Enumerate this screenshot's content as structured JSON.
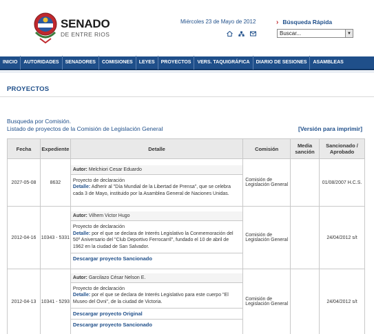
{
  "header": {
    "brand_title": "SENADO",
    "brand_subtitle": "DE ENTRE RIOS",
    "date": "Miércoles 23 de Mayo de 2012",
    "icons": [
      "home-icon",
      "sitemap-icon",
      "mail-icon"
    ],
    "quick_search_label": "Búsqueda Rápida",
    "quick_search_select": "Buscar..."
  },
  "nav": {
    "items": [
      "INICIO",
      "AUTORIDADES",
      "SENADORES",
      "COMISIONES",
      "LEYES",
      "PROYECTOS",
      "VERS. TAQUIGRÁFICA",
      "DIARIO DE SESIONES",
      "ASAMBLEAS"
    ]
  },
  "page": {
    "title": "PROYECTOS",
    "search_line1": "Busqueda por Comisión.",
    "search_line2": "Listado de proyectos de la Comisión de Legislación General",
    "print_link": "[Versión para imprimir]"
  },
  "table": {
    "headers": {
      "fecha": "Fecha",
      "expediente": "Expediente",
      "detalle": "Detalle",
      "comision": "Comisión",
      "media": "Media sanción",
      "sancionado": "Sancionado / Aprobado"
    },
    "author_label": "Autor:",
    "detail_label": "Detalle:",
    "rows": [
      {
        "fecha": "2027-05-08",
        "expediente": "8632",
        "autor": "Melchiori Cesar Eduardo",
        "tipo": "Proyecto de declaración",
        "detalle": "Adherir al \"Día Mundial de la Libertad de Prensa\", que se celebra cada 3 de Mayo, instituido por la Asamblea General de Naciones Unidas.",
        "comision": "Comisión de Legislación General",
        "media": "",
        "sancionado": "01/08/2007 H.C.S.",
        "links": []
      },
      {
        "fecha": "2012-04-16",
        "expediente": "10343 - 5331",
        "autor": "Vilhem Victor Hugo",
        "tipo": "Proyecto de declaración",
        "detalle": "por el que se declara de Interés Legislativo la Conmemoración del 50º Aniversario del \"Club Deportivo Ferrocarril\", fundado el 10 de abril de 1962 en la ciudad de San Salvador.",
        "comision": "Comisión de Legislación General",
        "media": "",
        "sancionado": "24/04/2012 s/t",
        "links": [
          "Descargar proyecto Sancionado"
        ]
      },
      {
        "fecha": "2012-04-13",
        "expediente": "10341 - 5293",
        "autor": "Garcilazo César Nelson E.",
        "tipo": "Proyecto de declaración",
        "detalle": "por el que se declara de Interés Legislativo para este cuerpo \"El Museo del Ovni\", de la ciudad de Victoria.",
        "comision": "Comisión de Legislación General",
        "media": "",
        "sancionado": "24/04/2012 s/t",
        "links": [
          "Descargar proyecto Original",
          "Descargar proyecto Sancionado"
        ]
      }
    ]
  },
  "colors": {
    "brand_blue": "#1f4f8a",
    "brand_red": "#c0282d",
    "header_gray": "#e9e9e9"
  }
}
